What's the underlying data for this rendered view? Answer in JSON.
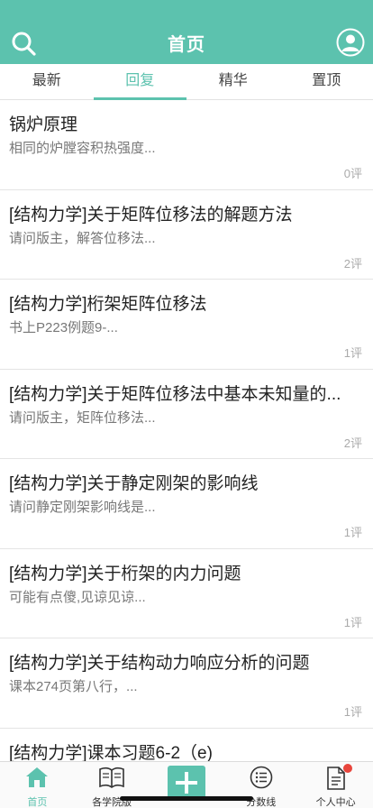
{
  "header": {
    "title": "首页",
    "search_icon": "search-icon",
    "avatar_icon": "user-avatar-icon"
  },
  "tabs": [
    {
      "label": "最新"
    },
    {
      "label": "回复"
    },
    {
      "label": "精华"
    },
    {
      "label": "置顶"
    }
  ],
  "active_tab": "回复",
  "posts": [
    {
      "title": "锅炉原理",
      "snippet": "相同的炉膛容积热强度...",
      "comments": "0评"
    },
    {
      "title": "[结构力学]关于矩阵位移法的解题方法",
      "snippet": "请问版主，解答位移法...",
      "comments": "2评"
    },
    {
      "title": "[结构力学]桁架矩阵位移法",
      "snippet": "书上P223例题9-...",
      "comments": "1评"
    },
    {
      "title": "[结构力学]关于矩阵位移法中基本未知量的...",
      "snippet": "请问版主，矩阵位移法...",
      "comments": "2评"
    },
    {
      "title": "[结构力学]关于静定刚架的影响线",
      "snippet": "请问静定刚架影响线是...",
      "comments": "1评"
    },
    {
      "title": "[结构力学]关于桁架的内力问题",
      "snippet": "可能有点傻,见谅见谅...",
      "comments": "1评"
    },
    {
      "title": "[结构力学]关于结构动力响应分析的问题",
      "snippet": "课本274页第八行，...",
      "comments": "1评"
    },
    {
      "title": "[结构力学]课本习题6-2（e)",
      "snippet": "",
      "comments": ""
    }
  ],
  "tabbar": [
    {
      "label": "首页",
      "icon": "home-icon"
    },
    {
      "label": "各学院版",
      "icon": "book-icon"
    },
    {
      "label": "",
      "icon": "plus-icon"
    },
    {
      "label": "分数线",
      "icon": "list-icon"
    },
    {
      "label": "个人中心",
      "icon": "document-icon"
    }
  ],
  "colors": {
    "accent": "#5cc2ae",
    "badge": "#e8453c"
  }
}
